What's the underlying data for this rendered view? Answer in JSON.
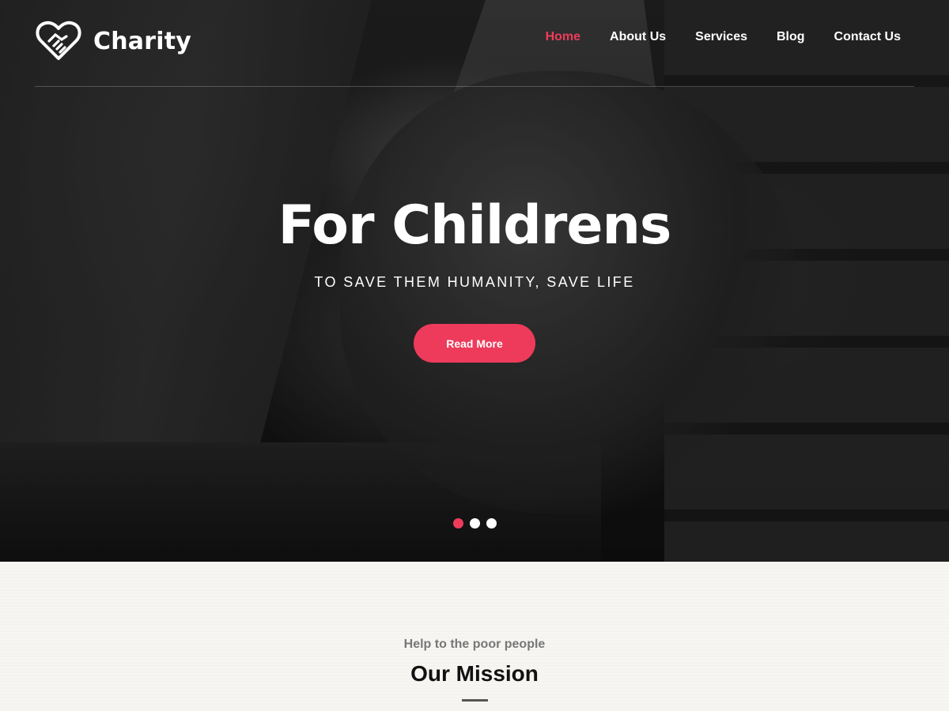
{
  "brand": {
    "name": "Charity",
    "icon": "handshake-heart-icon"
  },
  "nav": {
    "items": [
      {
        "label": "Home",
        "active": true
      },
      {
        "label": "About Us",
        "active": false
      },
      {
        "label": "Services",
        "active": false
      },
      {
        "label": "Blog",
        "active": false
      },
      {
        "label": "Contact Us",
        "active": false
      }
    ]
  },
  "hero": {
    "title": "For Childrens",
    "subtitle": "TO SAVE THEM HUMANITY, SAVE LIFE",
    "cta_label": "Read More",
    "slides_count": 3,
    "active_slide": 1
  },
  "mission": {
    "kicker": "Help to the poor people",
    "title": "Our Mission"
  },
  "colors": {
    "accent": "#ee3b5b",
    "text_light": "#ffffff",
    "dark": "#111111"
  }
}
